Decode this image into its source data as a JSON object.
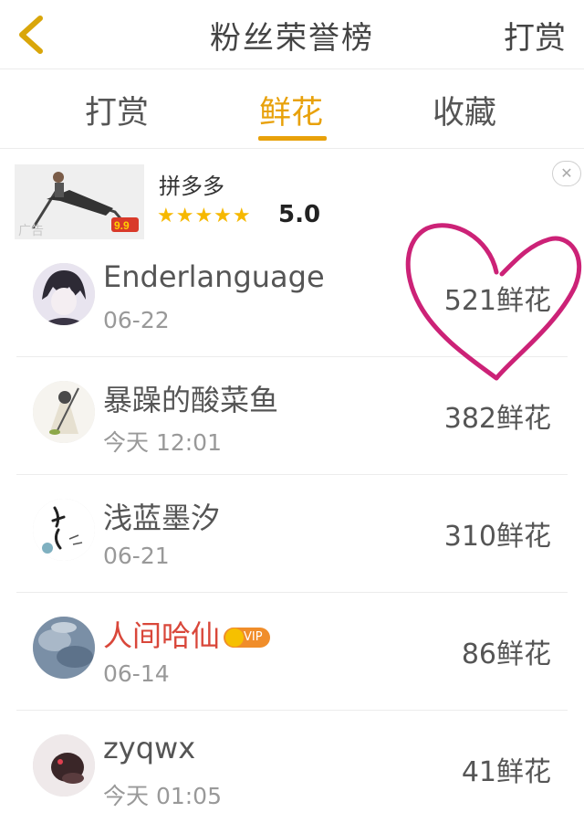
{
  "header": {
    "title": "粉丝荣誉榜",
    "action_label": "打赏",
    "back_icon": "chevron-left-icon"
  },
  "tabs": [
    {
      "label": "打赏",
      "active": false
    },
    {
      "label": "鲜花",
      "active": true
    },
    {
      "label": "收藏",
      "active": false
    }
  ],
  "ad": {
    "name": "拼多多",
    "stars": "★★★★★",
    "rating": "5.0",
    "tag": "广告",
    "price_label": "9.9",
    "close_icon": "close-icon"
  },
  "rows": [
    {
      "username": "Enderlanguage",
      "time": "06-22",
      "count": "521鲜花",
      "vip": false
    },
    {
      "username": "暴躁的酸菜鱼",
      "time": "今天 12:01",
      "count": "382鲜花",
      "vip": false
    },
    {
      "username": "浅蓝墨汐",
      "time": "06-21",
      "count": "310鲜花",
      "vip": false
    },
    {
      "username": "人间哈仙",
      "time": "06-14",
      "count": "86鲜花",
      "vip": true,
      "badge": "VIP"
    },
    {
      "username": "zyqwx",
      "time": "今天 01:05",
      "count": "41鲜花",
      "vip": false
    }
  ],
  "colors": {
    "accent": "#e8a10a",
    "vip_name": "#d9473a",
    "heart_annotation": "#cc2277"
  }
}
